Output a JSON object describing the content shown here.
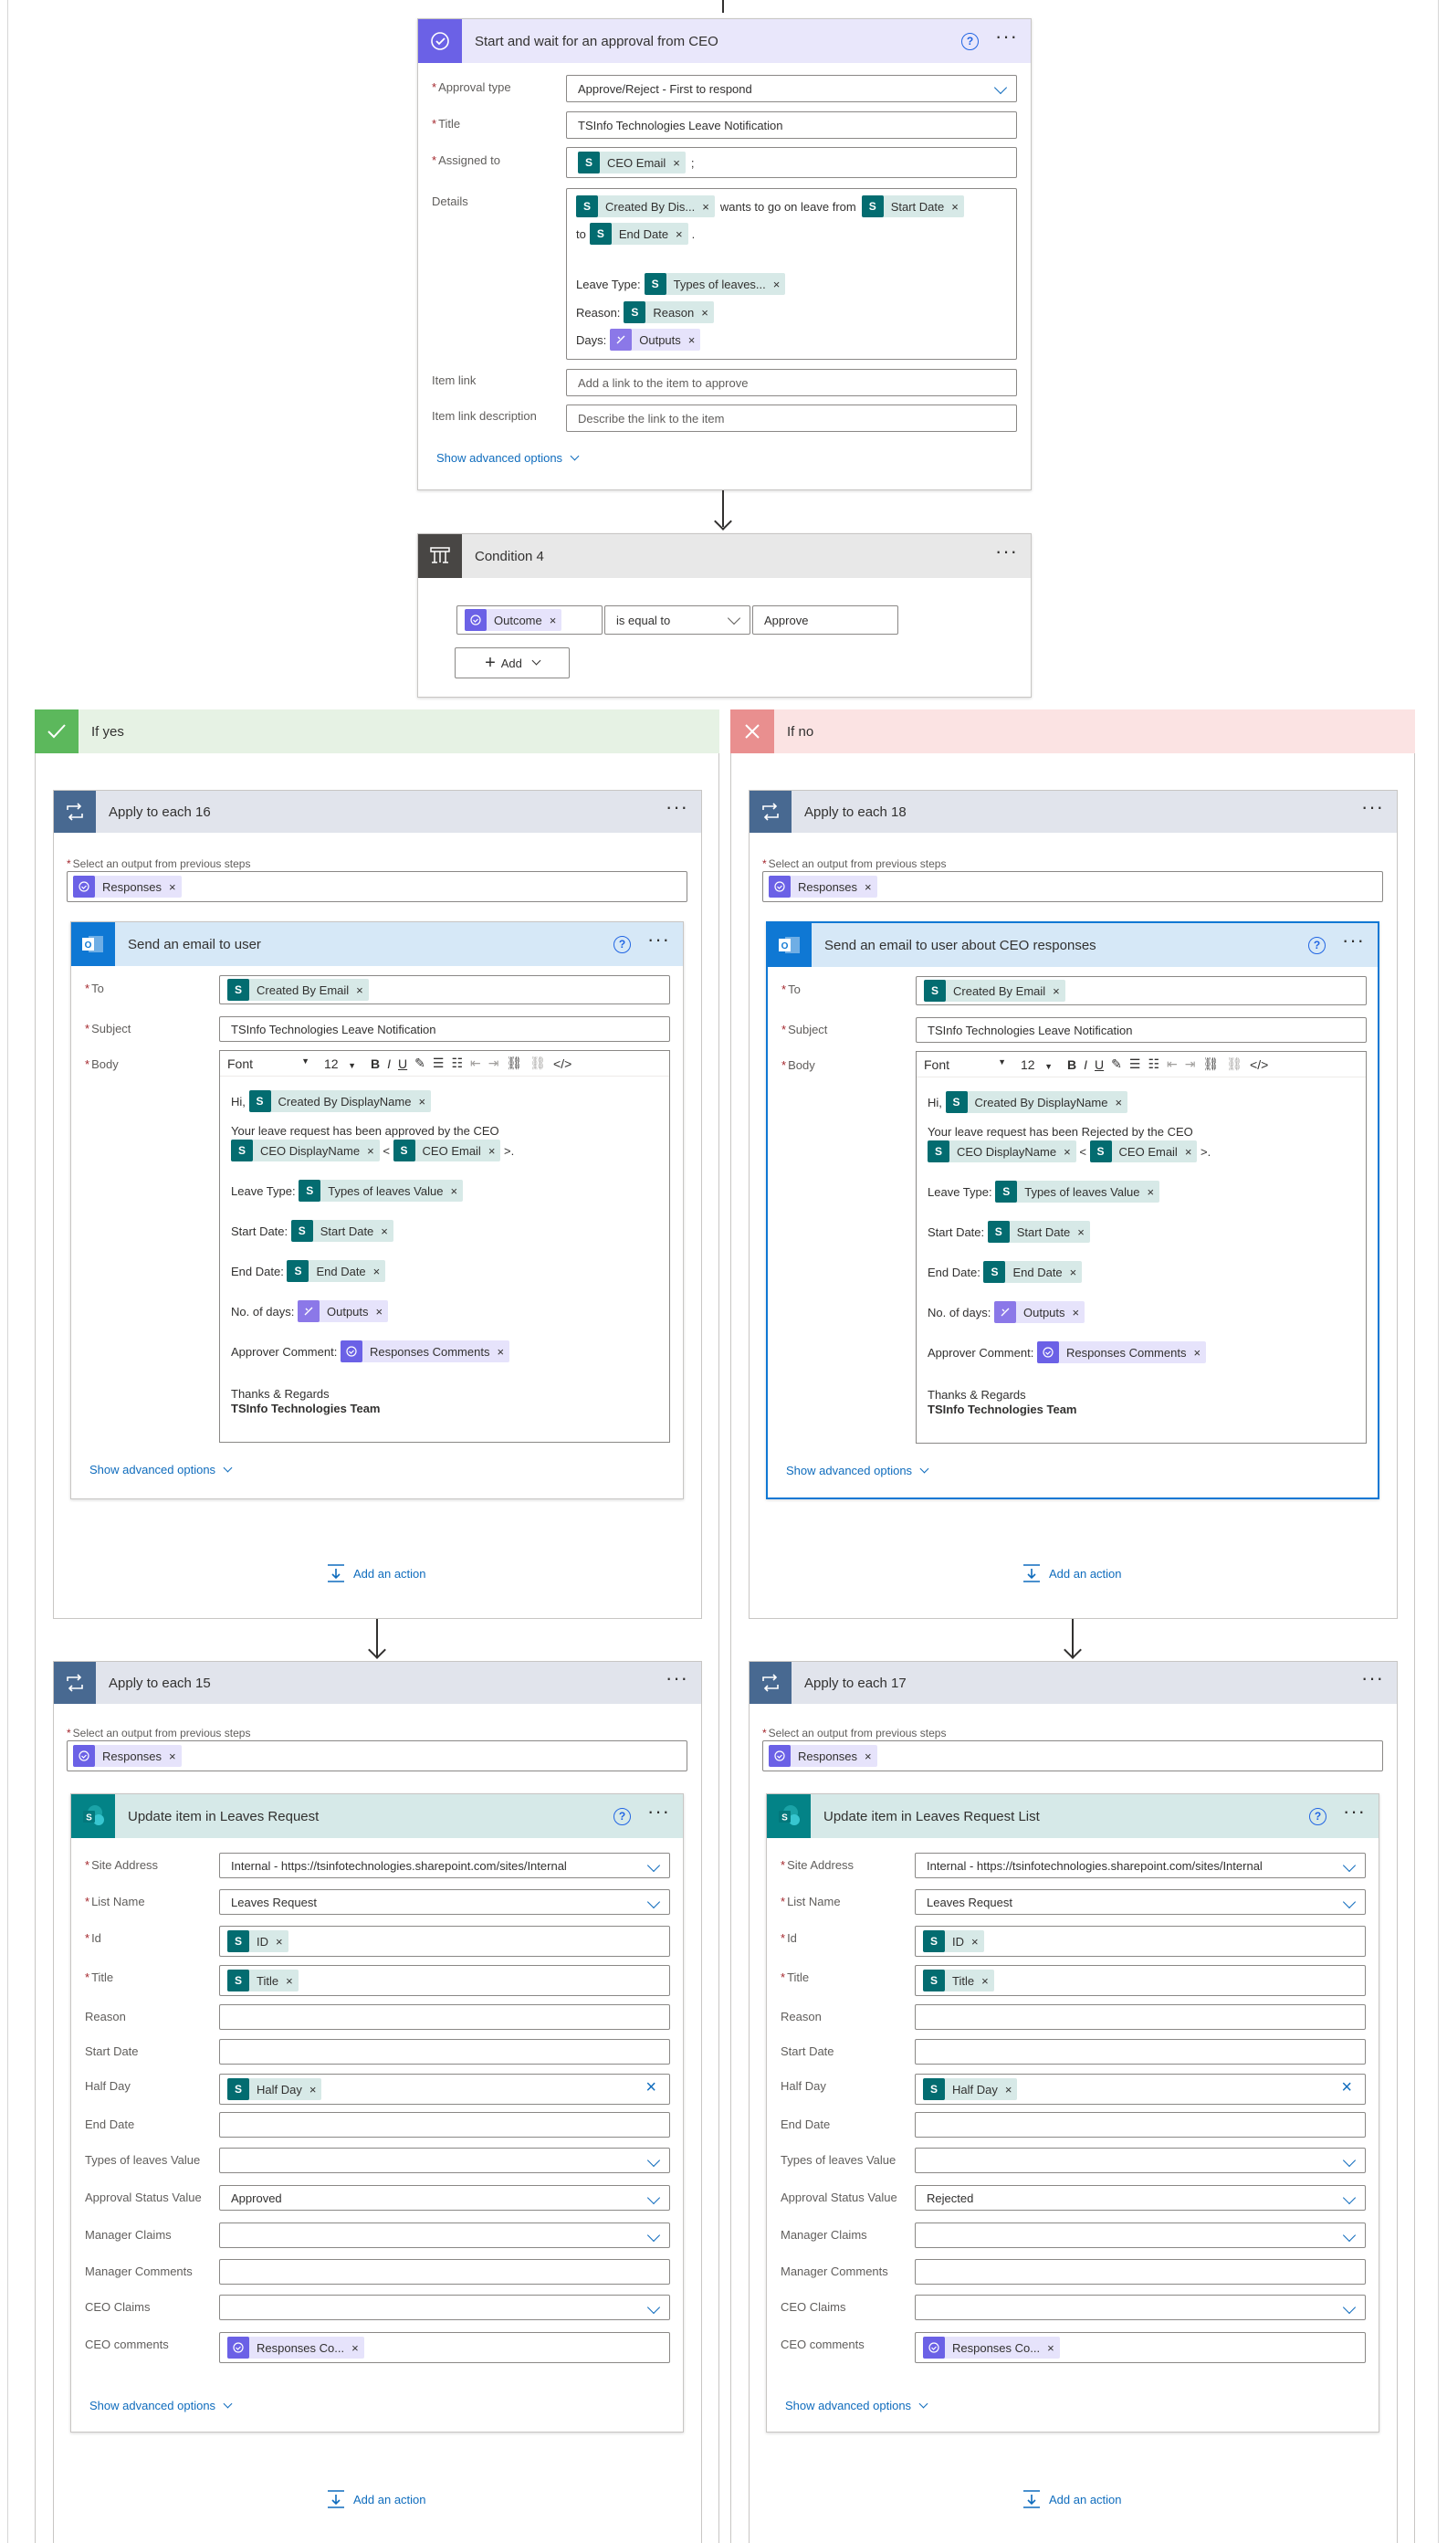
{
  "approval": {
    "title": "Start and wait for an approval from CEO",
    "help": "?",
    "more": "···",
    "type_label": "Approval type",
    "type_value": "Approve/Reject - First to respond",
    "title_label": "Title",
    "title_value": "TSInfo Technologies Leave Notification",
    "assigned_label": "Assigned to",
    "assigned_token": "CEO Email",
    "assigned_sep": ";",
    "details_label": "Details",
    "d_tok1": "Created By Dis...",
    "d_text1": "wants to go on leave from",
    "d_tok2": "Start Date",
    "d_to": "to",
    "d_tok3": "End Date",
    "d_dot": ".",
    "d_lt": "Leave Type:",
    "d_tok4": "Types of leaves...",
    "d_reason": "Reason:",
    "d_tok5": "Reason",
    "d_days": "Days:",
    "d_tok6": "Outputs",
    "link_label": "Item link",
    "link_ph": "Add a link to the item to approve",
    "linkdesc_label": "Item link description",
    "linkdesc_ph": "Describe the link to the item",
    "adv": "Show advanced options"
  },
  "condition": {
    "title": "Condition 4",
    "more": "···",
    "token": "Outcome",
    "op": "is equal to",
    "value": "Approve",
    "add": "Add"
  },
  "yes": {
    "title": "If yes",
    "loop1": {
      "title": "Apply to each 16",
      "more": "···",
      "sel_label": "Select an output from previous steps",
      "token": "Responses"
    },
    "email": {
      "title": "Send an email to user",
      "help": "?",
      "more": "···",
      "to_label": "To",
      "to_token": "Created By Email",
      "subject_label": "Subject",
      "subject": "TSInfo Technologies  Leave Notification",
      "body_label": "Body",
      "font": "Font",
      "size": "12",
      "hi": "Hi,",
      "hi_tok": "Created By DisplayName",
      "approved_text": "Your leave request has been approved by the CEO",
      "ceo_name": "CEO DisplayName",
      "lt": "<",
      "ceo_email": "CEO Email",
      "gt": ">.",
      "lt_label": "Leave Type:",
      "lt_tok": "Types of leaves Value",
      "sd_label": "Start Date:",
      "sd_tok": "Start Date",
      "ed_label": "End Date:",
      "ed_tok": "End Date",
      "nd_label": "No. of days:",
      "nd_tok": "Outputs",
      "ac_label": "Approver Comment:",
      "ac_tok": "Responses Comments",
      "thanks": "Thanks & Regards",
      "team": "TSInfo Technologies Team",
      "adv": "Show advanced options"
    },
    "add_action": "Add an action",
    "loop2": {
      "title": "Apply to each 15",
      "more": "···",
      "sel_label": "Select an output from previous steps",
      "token": "Responses"
    },
    "update": {
      "title": "Update item in Leaves Request",
      "help": "?",
      "more": "···",
      "site_label": "Site Address",
      "site": "Internal - https://tsinfotechnologies.sharepoint.com/sites/Internal",
      "list_label": "List Name",
      "list": "Leaves Request",
      "id_label": "Id",
      "id_tok": "ID",
      "title_label": "Title",
      "title_tok": "Title",
      "reason_label": "Reason",
      "start_label": "Start Date",
      "half_label": "Half Day",
      "half_tok": "Half Day",
      "end_label": "End Date",
      "types_label": "Types of leaves Value",
      "status_label": "Approval Status Value",
      "status": "Approved",
      "mclaims_label": "Manager Claims",
      "mcomments_label": "Manager Comments",
      "cclaims_label": "CEO Claims",
      "ccomments_label": "CEO comments",
      "ccomments_tok": "Responses Co...",
      "adv": "Show advanced options"
    },
    "add_action2": "Add an action"
  },
  "no": {
    "title": "If no",
    "loop1": {
      "title": "Apply to each 18",
      "more": "···",
      "sel_label": "Select an output from previous steps",
      "token": "Responses"
    },
    "email": {
      "title": "Send an email to user about CEO responses",
      "help": "?",
      "more": "···",
      "to_label": "To",
      "to_token": "Created By Email",
      "subject_label": "Subject",
      "subject": "TSInfo Technologies  Leave Notification",
      "body_label": "Body",
      "font": "Font",
      "size": "12",
      "hi": "Hi,",
      "hi_tok": "Created By DisplayName",
      "approved_text": "Your leave request has been Rejected by the CEO",
      "ceo_name": "CEO DisplayName",
      "lt": "<",
      "ceo_email": "CEO Email",
      "gt": ">.",
      "lt_label": "Leave Type:",
      "lt_tok": "Types of leaves Value",
      "sd_label": "Start Date:",
      "sd_tok": "Start Date",
      "ed_label": "End Date:",
      "ed_tok": "End Date",
      "nd_label": "No. of days:",
      "nd_tok": "Outputs",
      "ac_label": "Approver Comment:",
      "ac_tok": "Responses Comments",
      "thanks": "Thanks & Regards",
      "team": "TSInfo Technologies Team",
      "adv": "Show advanced options"
    },
    "add_action": "Add an action",
    "loop2": {
      "title": "Apply to each 17",
      "more": "···",
      "sel_label": "Select an output from previous steps",
      "token": "Responses"
    },
    "update": {
      "title": "Update item in Leaves Request List",
      "help": "?",
      "more": "···",
      "site_label": "Site Address",
      "site": "Internal - https://tsinfotechnologies.sharepoint.com/sites/Internal",
      "list_label": "List Name",
      "list": "Leaves Request",
      "id_label": "Id",
      "id_tok": "ID",
      "title_label": "Title",
      "title_tok": "Title",
      "reason_label": "Reason",
      "start_label": "Start Date",
      "half_label": "Half Day",
      "half_tok": "Half Day",
      "end_label": "End Date",
      "types_label": "Types of leaves Value",
      "status_label": "Approval Status Value",
      "status": "Rejected",
      "mclaims_label": "Manager Claims",
      "mcomments_label": "Manager Comments",
      "cclaims_label": "CEO Claims",
      "ccomments_label": "CEO comments",
      "ccomments_tok": "Responses Co...",
      "adv": "Show advanced options"
    },
    "add_action2": "Add an action"
  },
  "icons": {
    "close": "×",
    "sharepoint": "S"
  },
  "colors": {
    "approval_header": "#e9e7fb",
    "approval_icon": "#6b61e6",
    "condition_header": "#e8e8e8",
    "condition_icon": "#484644",
    "yes_header": "#e6f2e4",
    "yes_icon": "#5cb85c",
    "no_header": "#fbe3e3",
    "no_icon": "#e98f8f",
    "loop_header": "#e1e4ec",
    "loop_icon": "#486991",
    "outlook_header": "#d6e8f7",
    "outlook_icon": "#0f78d4",
    "sharepoint_header": "#d6e9e8",
    "sharepoint_icon": "#038387",
    "link": "#0f6cbd"
  }
}
